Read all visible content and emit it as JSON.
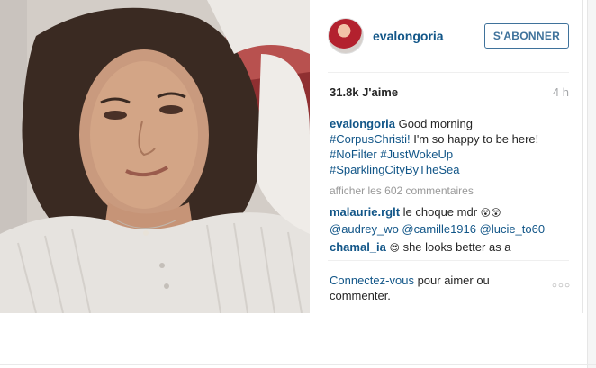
{
  "post": {
    "username": "evalongoria",
    "follow_label": "S'ABONNER",
    "likes": "31.8k J'aime",
    "time": "4 h",
    "caption": {
      "user": "evalongoria",
      "text_1": "Good morning",
      "tag_1": "#CorpusChristi!",
      "text_2": " I'm so happy to be here!",
      "tag_2": "#NoFilter",
      "tag_3": "#JustWokeUp",
      "tag_4": "#SparklingCityByTheSea"
    },
    "load_comments": "afficher les 602 commentaires",
    "comments": [
      {
        "user": "malaurie.rglt",
        "text": " le choque mdr ",
        "emoji": "😵😵",
        "mentions": [
          "@audrey_wo",
          "@camille1916",
          "@lucie_to60"
        ]
      },
      {
        "user": "chamal_ia",
        "emoji": "😍",
        "text": " she looks better as a"
      }
    ],
    "login_prompt": {
      "link": "Connectez-vous",
      "text": " pour aimer ou commenter."
    },
    "more_label": "○○○"
  }
}
